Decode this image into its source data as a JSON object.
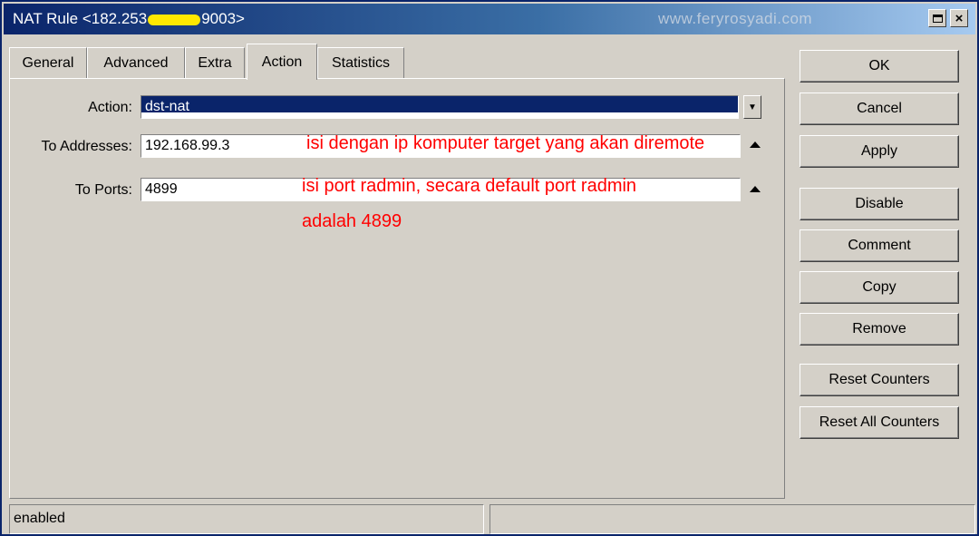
{
  "window": {
    "title_prefix": "NAT Rule <182.253",
    "title_suffix": "9003>",
    "watermark": "www.feryrosyadi.com"
  },
  "tabs": [
    {
      "label": "General",
      "active": false
    },
    {
      "label": "Advanced",
      "active": false
    },
    {
      "label": "Extra",
      "active": false
    },
    {
      "label": "Action",
      "active": true
    },
    {
      "label": "Statistics",
      "active": false
    }
  ],
  "form": {
    "action_label": "Action:",
    "action_value": "dst-nat",
    "to_addresses_label": "To Addresses:",
    "to_addresses_value": "192.168.99.3",
    "to_ports_label": "To Ports:",
    "to_ports_value": "4899"
  },
  "annotations": {
    "address_note": "isi dengan ip komputer target yang akan diremote",
    "ports_note_line1": "isi port radmin, secara default port radmin",
    "ports_note_line2": "adalah 4899"
  },
  "buttons": {
    "ok": "OK",
    "cancel": "Cancel",
    "apply": "Apply",
    "disable": "Disable",
    "comment": "Comment",
    "copy": "Copy",
    "remove": "Remove",
    "reset_counters": "Reset Counters",
    "reset_all_counters": "Reset All Counters"
  },
  "status": {
    "left": "enabled",
    "right": ""
  },
  "colors": {
    "titlebar": "#0a246a",
    "selection": "#0a246a",
    "annotation": "#ff0000",
    "redaction": "#ffe800"
  }
}
